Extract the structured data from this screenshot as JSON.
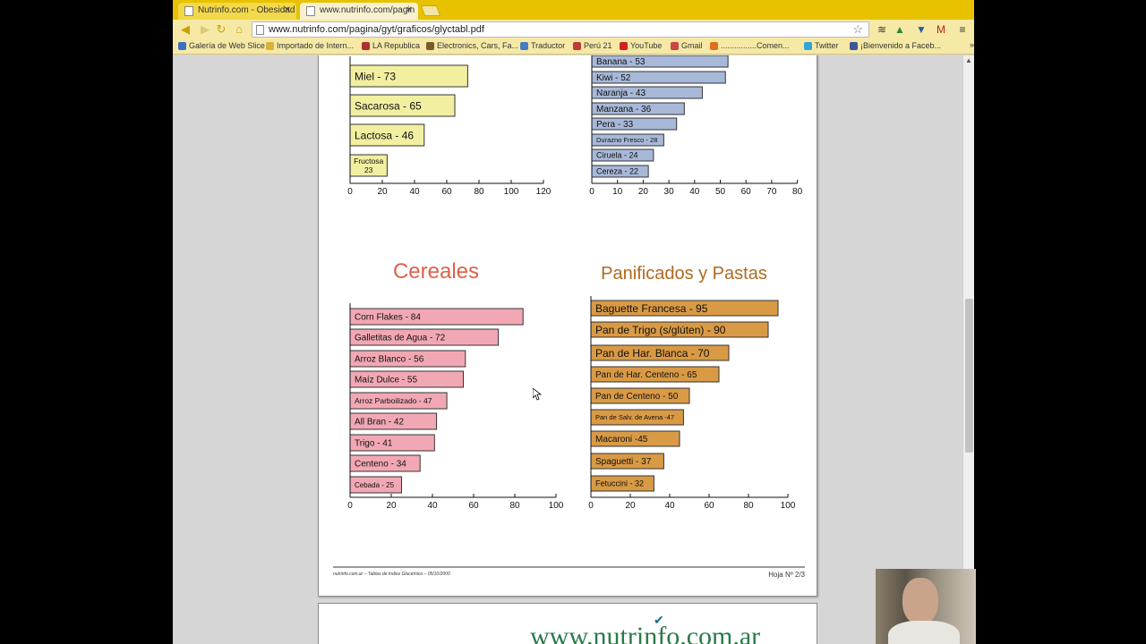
{
  "tabs": [
    {
      "title": "Nutrinfo.com - Obesidad",
      "active": false
    },
    {
      "title": "www.nutrinfo.com/pagin",
      "active": true
    }
  ],
  "toolbar": {
    "url": "www.nutrinfo.com/pagina/gyt/graficos/glyctabl.pdf"
  },
  "bookmarks": [
    {
      "label": "Galería de Web Slice",
      "color": "#3a6fc4"
    },
    {
      "label": "Importado de Intern...",
      "color": "#d9b23a"
    },
    {
      "label": "LA Republica",
      "color": "#b03030"
    },
    {
      "label": "Electronics, Cars, Fa...",
      "color": "#7a5a2a"
    },
    {
      "label": "Traductor",
      "color": "#4a7ac4"
    },
    {
      "label": "Perú 21",
      "color": "#c03a3a"
    },
    {
      "label": "YouTube",
      "color": "#d02020"
    },
    {
      "label": "Gmail",
      "color": "#c44"
    },
    {
      "label": "................Comen...",
      "color": "#e07020"
    },
    {
      "label": "Twitter",
      "color": "#33a4d8"
    },
    {
      "label": "¡Bienvenido a Faceb...",
      "color": "#3b5998"
    }
  ],
  "pdf": {
    "footer_left": "nutrinfo.com.ar – Tablas de Indice Glucémico – 05/10/2000",
    "footer_right": "Hoja Nº 2/3",
    "next_page_text": "www.nutrinfo.com.ar"
  },
  "colors": {
    "sugar_bar": "#f2f0a0",
    "fruit_bar": "#a8b8d8",
    "cereal_bar": "#f2a8b4",
    "bread_bar": "#d99a45",
    "cereal_title": "#e0604a",
    "bread_title": "#b06a20"
  },
  "chart_data": [
    {
      "type": "bar",
      "orientation": "horizontal",
      "title": "",
      "categories": [
        "Miel - 73",
        "Sacarosa - 65",
        "Lactosa - 46",
        "Fructosa 23"
      ],
      "values": [
        73,
        65,
        46,
        23
      ],
      "xlim": [
        0,
        120
      ],
      "ticks": [
        "0",
        "20",
        "40",
        "60",
        "80",
        "100",
        "120"
      ],
      "note": "partially scrolled out of view"
    },
    {
      "type": "bar",
      "orientation": "horizontal",
      "title": "",
      "categories": [
        "Banana - 53",
        "Kiwi - 52",
        "Naranja - 43",
        "Manzana - 36",
        "Pera - 33",
        "Durazno Fresco - 28",
        "Ciruela - 24",
        "Cereza - 22"
      ],
      "values": [
        53,
        52,
        43,
        36,
        33,
        28,
        24,
        22
      ],
      "xlim": [
        0,
        80
      ],
      "ticks": [
        "0",
        "10",
        "20",
        "30",
        "40",
        "50",
        "60",
        "70",
        "80"
      ]
    },
    {
      "type": "bar",
      "orientation": "horizontal",
      "title": "Cereales",
      "categories": [
        "Corn Flakes - 84",
        "Galletitas de Agua - 72",
        "Arroz Blanco - 56",
        "Maíz Dulce - 55",
        "Arroz Parboilizado - 47",
        "All Bran - 42",
        "Trigo - 41",
        "Centeno - 34",
        "Cebada - 25"
      ],
      "values": [
        84,
        72,
        56,
        55,
        47,
        42,
        41,
        34,
        25
      ],
      "xlim": [
        0,
        100
      ],
      "ticks": [
        "0",
        "20",
        "40",
        "60",
        "80",
        "100"
      ]
    },
    {
      "type": "bar",
      "orientation": "horizontal",
      "title": "Panificados y Pastas",
      "categories": [
        "Baguette Francesa - 95",
        "Pan de Trigo (s/glúten) - 90",
        "Pan de Har. Blanca - 70",
        "Pan de Har. Centeno - 65",
        "Pan de Centeno - 50",
        "Pan de Salv. de Avena -47",
        "Macaroni -45",
        "Spaguetti - 37",
        "Fetuccini - 32"
      ],
      "values": [
        95,
        90,
        70,
        65,
        50,
        47,
        45,
        37,
        32
      ],
      "xlim": [
        0,
        100
      ],
      "ticks": [
        "0",
        "20",
        "40",
        "60",
        "80",
        "100"
      ]
    }
  ]
}
